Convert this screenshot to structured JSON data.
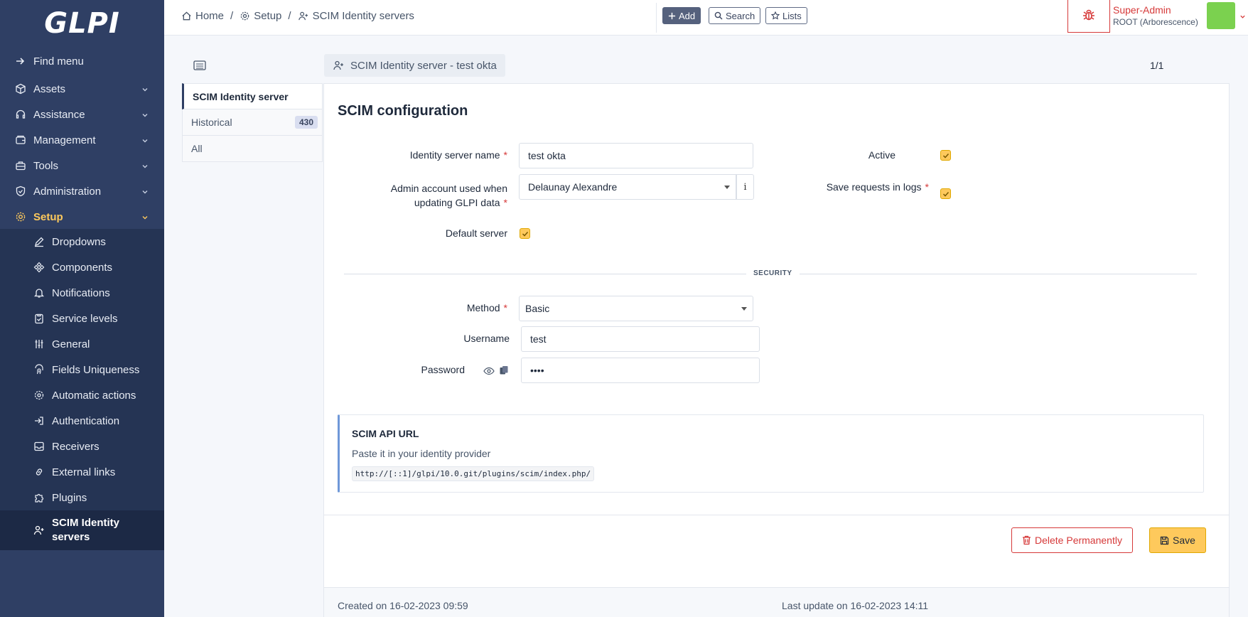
{
  "app": {
    "logo_text": "GLPI"
  },
  "sidebar": {
    "find_menu": "Find menu",
    "items": [
      {
        "label": "Assets"
      },
      {
        "label": "Assistance"
      },
      {
        "label": "Management"
      },
      {
        "label": "Tools"
      },
      {
        "label": "Administration"
      },
      {
        "label": "Setup"
      }
    ],
    "setup_items": [
      {
        "label": "Dropdowns"
      },
      {
        "label": "Components"
      },
      {
        "label": "Notifications"
      },
      {
        "label": "Service levels"
      },
      {
        "label": "General"
      },
      {
        "label": "Fields Uniqueness"
      },
      {
        "label": "Automatic actions"
      },
      {
        "label": "Authentication"
      },
      {
        "label": "Receivers"
      },
      {
        "label": "External links"
      },
      {
        "label": "Plugins"
      },
      {
        "label_line1": "SCIM Identity",
        "label_line2": "servers"
      }
    ]
  },
  "breadcrumb": {
    "home": "Home",
    "setup": "Setup",
    "current": "SCIM Identity servers"
  },
  "toolbar": {
    "add": "Add",
    "search": "Search",
    "lists": "Lists"
  },
  "user": {
    "profile": "Super-Admin",
    "entity": "ROOT (Arborescence)"
  },
  "item": {
    "title": "SCIM Identity server - test okta",
    "pager": "1/1"
  },
  "tabs": [
    {
      "label": "SCIM Identity server"
    },
    {
      "label": "Historical",
      "count": "430"
    },
    {
      "label": "All"
    }
  ],
  "form": {
    "heading": "SCIM configuration",
    "name_label": "Identity server name",
    "name_value": "test okta",
    "admin_label_line1": "Admin account used when",
    "admin_label_line2": "updating GLPI data",
    "admin_value": "Delaunay Alexandre",
    "admin_info": "i",
    "default_label": "Default server",
    "active_label": "Active",
    "save_logs_label": "Save requests in logs",
    "section": "SECURITY",
    "method_label": "Method",
    "method_value": "Basic",
    "username_label": "Username",
    "username_value": "test",
    "password_label": "Password",
    "password_value": "••••"
  },
  "api": {
    "title": "SCIM API URL",
    "description": "Paste it in your identity provider",
    "url": "http://[::1]/glpi/10.0.git/plugins/scim/index.php/"
  },
  "actions": {
    "delete": "Delete Permanently",
    "save": "Save"
  },
  "footer": {
    "created": "Created on 16-02-2023 09:59",
    "updated": "Last update on 16-02-2023 14:11"
  },
  "colors": {
    "sidebar": "#2f3f64",
    "accent": "#fec95c",
    "danger": "#d63939"
  }
}
